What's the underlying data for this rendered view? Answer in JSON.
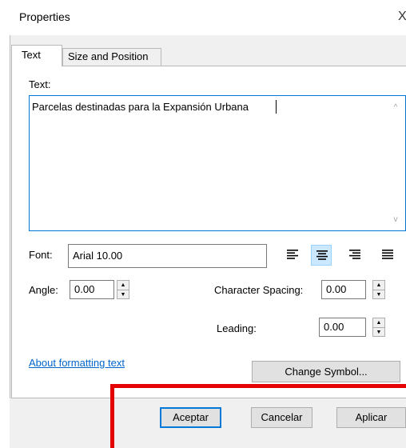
{
  "window": {
    "title": "Properties",
    "close_glyph": "X"
  },
  "tabs": [
    {
      "label": "Text",
      "active": true
    },
    {
      "label": "Size and Position",
      "active": false
    }
  ],
  "text_section": {
    "label": "Text:",
    "value": "Parcelas destinadas para la Expansión Urbana"
  },
  "font": {
    "label": "Font:",
    "value": "Arial 10.00"
  },
  "alignment": {
    "buttons": [
      {
        "name": "align-left-icon",
        "selected": false
      },
      {
        "name": "align-center-icon",
        "selected": true
      },
      {
        "name": "align-right-icon",
        "selected": false
      },
      {
        "name": "align-justify-icon",
        "selected": false
      }
    ]
  },
  "angle": {
    "label": "Angle:",
    "value": "0.00"
  },
  "character_spacing": {
    "label": "Character Spacing:",
    "value": "0.00"
  },
  "leading": {
    "label": "Leading:",
    "value": "0.00"
  },
  "links": {
    "about_formatting": "About formatting text"
  },
  "buttons": {
    "change_symbol": "Change Symbol...",
    "accept": "Aceptar",
    "cancel": "Cancelar",
    "apply": "Aplicar"
  },
  "spinner_icons": {
    "up": "▲",
    "down": "▼"
  },
  "scroll_icons": {
    "up": "^",
    "down": "v"
  },
  "colors": {
    "accent": "#0078d7",
    "selected_align": "#cce8ff",
    "link": "#0066cc",
    "annotation": "#e40000"
  }
}
